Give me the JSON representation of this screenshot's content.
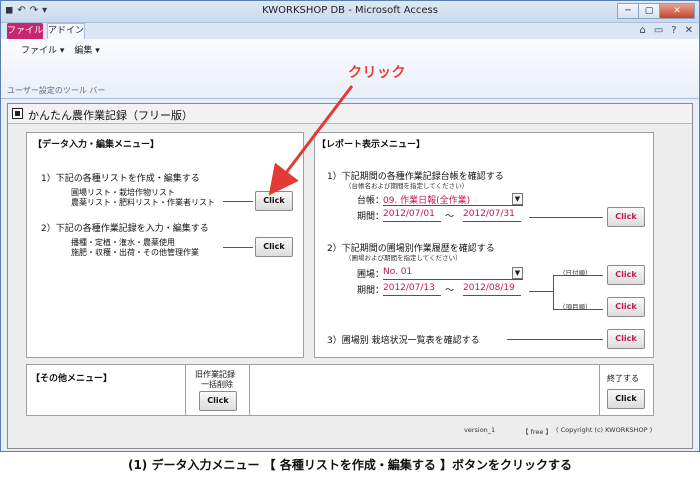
{
  "window": {
    "title": "KWORKSHOP DB - Microsoft Access",
    "qat": [
      "◼",
      "↶",
      "↷",
      "▾"
    ],
    "controls": [
      "─",
      "▢",
      "✕"
    ]
  },
  "ribbon": {
    "tab_file": "ファイル",
    "tab_addin": "アドイン",
    "right_controls": [
      "⌂",
      "▭",
      "?",
      "✕"
    ],
    "menus": [
      "ファイル ▾",
      "編集 ▾"
    ],
    "group_label": "ユーザー設定のツール バー"
  },
  "form": {
    "title": "かんたん農作業記録（フリー版）",
    "data_panel": {
      "title": "【データ入力・編集メニュー】",
      "item1": {
        "heading": "1）下記の各種リストを作成・編集する",
        "line1": "圃場リスト・栽培作物リスト",
        "line2": "農薬リスト・肥料リスト・作業者リスト",
        "button": "Click"
      },
      "item2": {
        "heading": "2）下記の各種作業記録を入力・編集する",
        "line1": "播種・定植・潅水・農薬使用",
        "line2": "施肥・収穫・出荷・その他管理作業",
        "button": "Click"
      }
    },
    "report_panel": {
      "title": "【レポート表示メニュー】",
      "item1": {
        "heading": "1）下記期間の各種作業記録台帳を確認する",
        "note": "（台帳名および期間を指定してください）",
        "ledger_label": "台帳：",
        "ledger_value": "09. 作業日報(全作業)",
        "period_label": "期間：",
        "from": "2012/07/01",
        "tilde": "～",
        "to": "2012/07/31",
        "button": "Click"
      },
      "item2": {
        "heading": "2）下記期間の圃場別作業履歴を確認する",
        "note": "（圃場および期間を指定してください）",
        "field_label": "圃場：",
        "field_value": "No. 01",
        "period_label": "期間：",
        "from": "2012/07/13",
        "tilde": "～",
        "to": "2012/08/19",
        "order_date": "（日付順）",
        "order_item": "（項目順）",
        "button_date": "Click",
        "button_item": "Click"
      },
      "item3": {
        "heading": "3）圃場別 栽培状況一覧表を確認する",
        "button": "Click"
      }
    },
    "other_panel": {
      "title": "【その他メニュー】",
      "bulk_label_1": "旧作業記録",
      "bulk_label_2": "一括削除",
      "bulk_button": "Click",
      "exit_label": "終了する",
      "exit_button": "Click"
    },
    "footer": {
      "version": "version_1",
      "edition": "【 free 】",
      "copyright": "( Copyright (c) KWORKSHOP )"
    }
  },
  "annotation": {
    "label": "クリック",
    "color": "#e53935"
  },
  "caption": "(1) データ入力メニュー 【 各種リストを作成・編集する 】ボタンをクリックする"
}
